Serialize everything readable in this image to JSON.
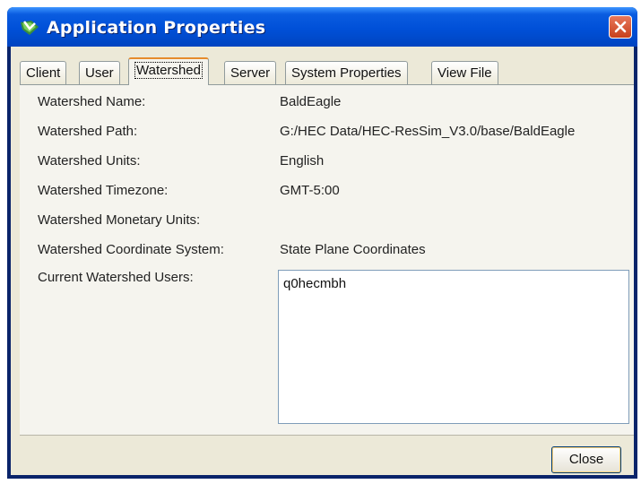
{
  "window": {
    "title": "Application Properties",
    "icon": "app-properties-icon",
    "close_icon": "close-icon"
  },
  "tabs": [
    {
      "label": "Client"
    },
    {
      "label": "User"
    },
    {
      "label": "Watershed",
      "selected": true
    },
    {
      "label": "Server"
    },
    {
      "label": "System Properties"
    },
    {
      "label": "View File"
    }
  ],
  "fields": [
    {
      "label": "Watershed Name:",
      "value": "BaldEagle"
    },
    {
      "label": "Watershed Path:",
      "value": "G:/HEC Data/HEC-ResSim_V3.0/base/BaldEagle"
    },
    {
      "label": "Watershed Units:",
      "value": "English"
    },
    {
      "label": "Watershed Timezone:",
      "value": "GMT-5:00"
    },
    {
      "label": "Watershed Monetary Units:",
      "value": ""
    },
    {
      "label": "Watershed Coordinate System:",
      "value": "State Plane Coordinates"
    }
  ],
  "users": {
    "label": "Current Watershed Users:",
    "list": [
      "q0hecmbh"
    ]
  },
  "buttons": {
    "close": "Close"
  },
  "colors": {
    "titlebar": "#0054e3",
    "dialog_bg": "#ece9d8",
    "active_tab_accent": "#e68b2c",
    "close_button": "#c7401d"
  }
}
